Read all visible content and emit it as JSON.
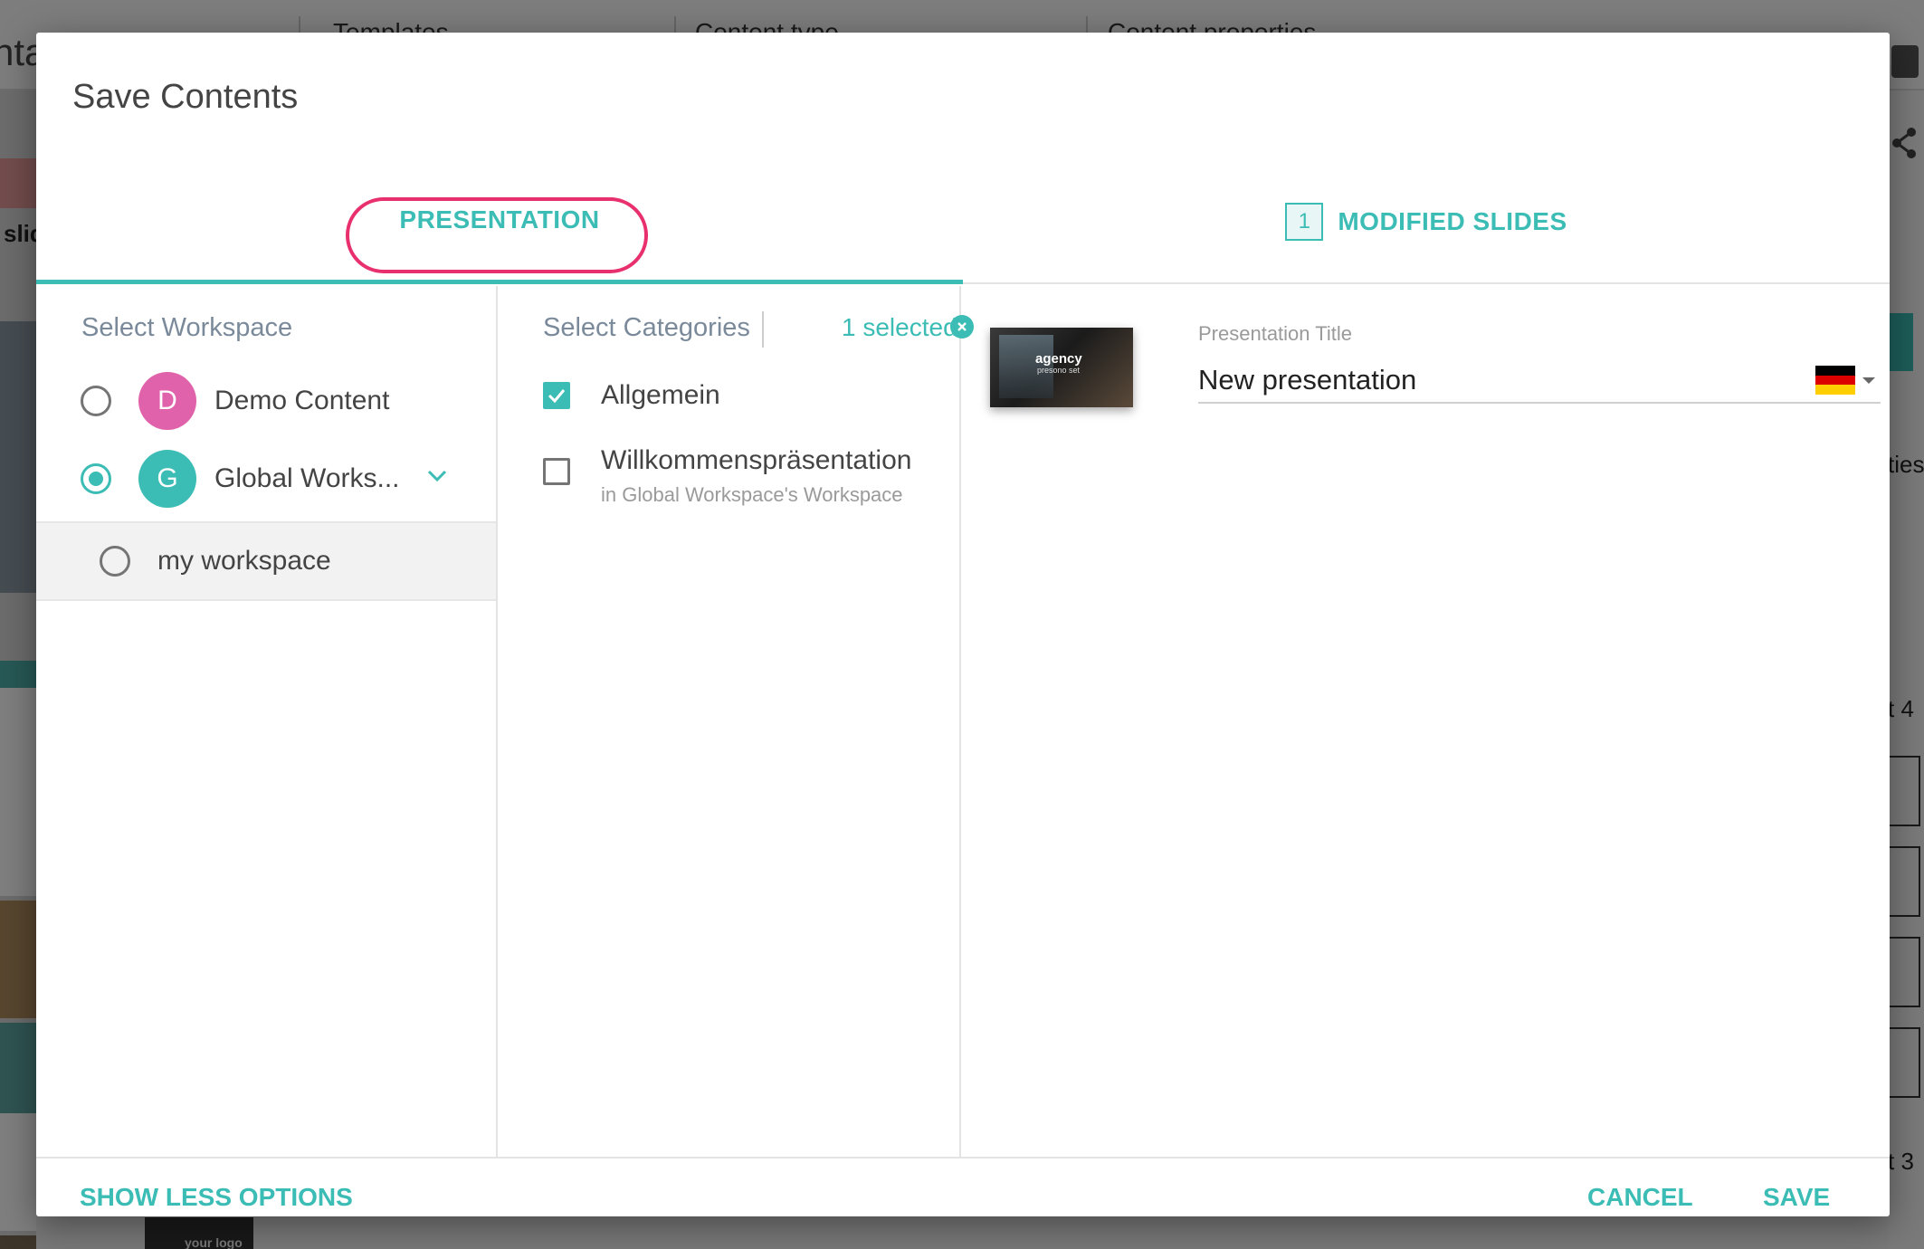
{
  "background": {
    "tabs": [
      "Templates",
      "Content type",
      "Content properties"
    ],
    "title_fragment": "ntat",
    "left_fragment": "slid",
    "right_fragments": [
      "ties",
      "t 4",
      "t 3"
    ],
    "logo_text": "your logo"
  },
  "dialog": {
    "title": "Save Contents",
    "tabs": {
      "presentation": "PRESENTATION",
      "modified_count": "1",
      "modified": "MODIFIED SLIDES"
    },
    "workspace": {
      "header": "Select Workspace",
      "items": [
        {
          "initial": "D",
          "label": "Demo Content",
          "color": "#e062ab",
          "selected": false
        },
        {
          "initial": "G",
          "label": "Global Works...",
          "color": "#3bbcb4",
          "selected": true
        }
      ],
      "sub_item": {
        "label": "my workspace",
        "selected": false
      }
    },
    "categories": {
      "header": "Select Categories",
      "selected_text": "1 selected",
      "items": [
        {
          "label": "Allgemein",
          "sub": "",
          "checked": true
        },
        {
          "label": "Willkommenspräsentation",
          "sub": "in Global Workspace's Workspace",
          "checked": false
        }
      ]
    },
    "details": {
      "thumb_title": "agency",
      "thumb_sub": "presono set",
      "field_label": "Presentation Title",
      "field_value": "New presentation",
      "language_flag": "german-flag-icon"
    },
    "footer": {
      "show_less": "SHOW LESS OPTIONS",
      "cancel": "CANCEL",
      "save": "SAVE"
    }
  },
  "colors": {
    "accent": "#3bbcb4",
    "highlight": "#e8306e",
    "avatar_d": "#e062ab",
    "avatar_g": "#3bbcb4"
  }
}
